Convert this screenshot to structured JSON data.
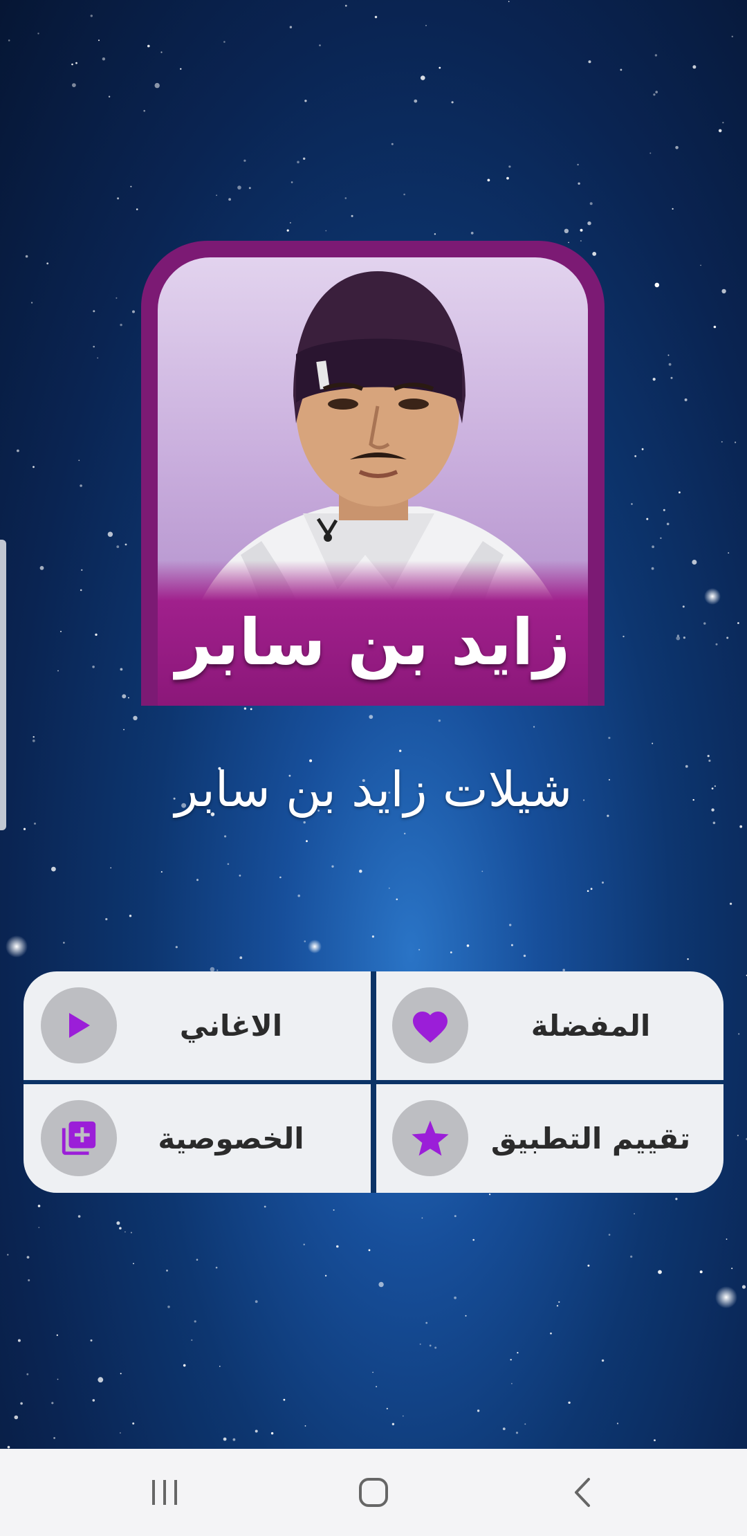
{
  "cover": {
    "caption": "زايد بن سابر"
  },
  "app_title": "شيلات زايد بن سابر",
  "menu": {
    "favorites": {
      "label": "المفضلة",
      "icon": "heart-icon"
    },
    "songs": {
      "label": "الاغاني",
      "icon": "play-icon"
    },
    "rate_app": {
      "label": "تقييم التطبيق",
      "icon": "star-icon"
    },
    "privacy": {
      "label": "الخصوصية",
      "icon": "library-add-icon"
    }
  },
  "navbar": {
    "recents_icon": "recents-icon",
    "home_icon": "home-icon",
    "back_icon": "back-icon"
  },
  "colors": {
    "accent": "#9b1ed8",
    "tile_bg": "#eef0f3",
    "icon_circle": "#bdbec2",
    "cover_frame": "#7c1a74"
  }
}
